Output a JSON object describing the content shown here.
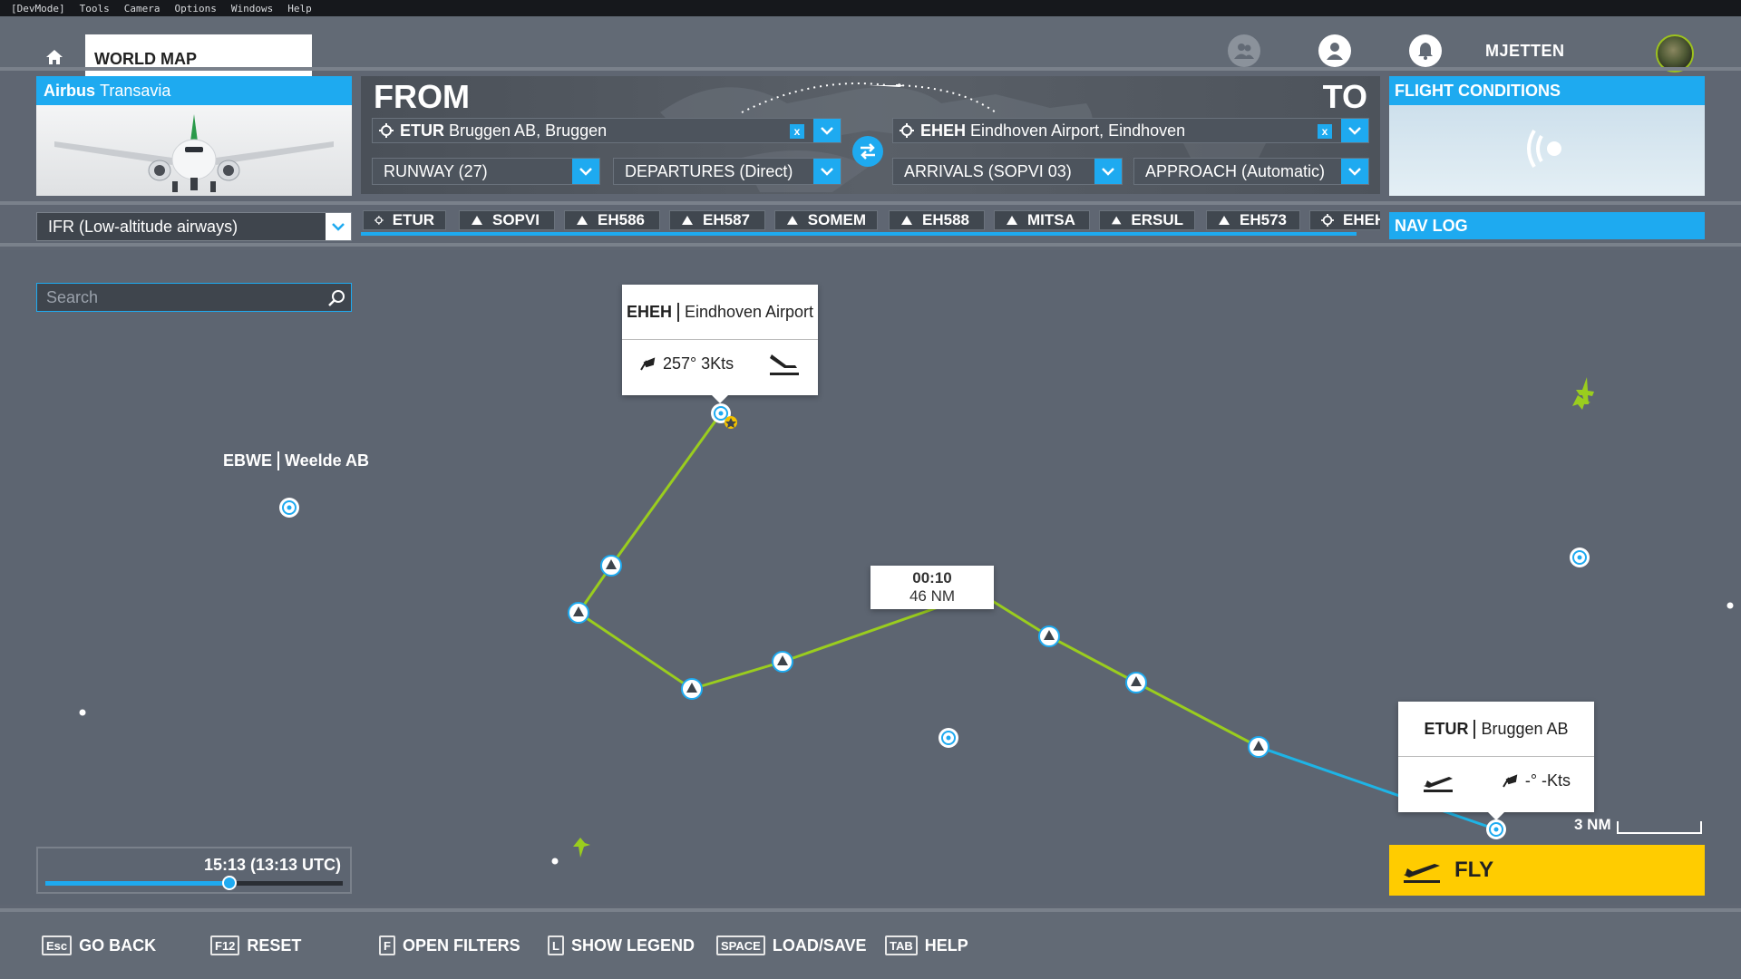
{
  "devmenu": [
    "[DevMode]",
    "Tools",
    "Camera",
    "Options",
    "Windows",
    "Help"
  ],
  "nav": {
    "tab_label": "WORLD MAP",
    "username": "MJETTEN"
  },
  "aircraft": {
    "brand": "Airbus",
    "livery": "Transavia"
  },
  "route": {
    "from_label": "FROM",
    "to_label": "TO",
    "from_code": "ETUR",
    "from_name": "Bruggen AB, Bruggen",
    "to_code": "EHEH",
    "to_name": "Eindhoven Airport, Eindhoven",
    "clear_glyph": "x",
    "runway": "RUNWAY (27)",
    "departure": "DEPARTURES (Direct)",
    "arrival": "ARRIVALS (SOPVI 03)",
    "approach": "APPROACH (Automatic)"
  },
  "flight_conditions": {
    "title": "FLIGHT CONDITIONS"
  },
  "flight_type": "IFR (Low-altitude airways)",
  "waypoints": [
    {
      "label": "ETUR",
      "icon": "airport-icon"
    },
    {
      "label": "SOPVI",
      "icon": "waypoint-triangle-icon"
    },
    {
      "label": "EH586",
      "icon": "waypoint-triangle-icon"
    },
    {
      "label": "EH587",
      "icon": "waypoint-triangle-icon"
    },
    {
      "label": "SOMEM",
      "icon": "waypoint-triangle-icon"
    },
    {
      "label": "EH588",
      "icon": "waypoint-triangle-icon"
    },
    {
      "label": "MITSA",
      "icon": "waypoint-triangle-icon"
    },
    {
      "label": "ERSUL",
      "icon": "waypoint-triangle-icon"
    },
    {
      "label": "EH573",
      "icon": "waypoint-triangle-icon"
    },
    {
      "label": "EHEH",
      "icon": "airport-icon"
    }
  ],
  "navlog": {
    "title": "NAV LOG"
  },
  "search": {
    "placeholder": "Search"
  },
  "map": {
    "dest_callout": {
      "code": "EHEH",
      "name": "Eindhoven Airport",
      "wind": "257° 3Kts"
    },
    "origin_callout": {
      "code": "ETUR",
      "name": "Bruggen AB",
      "wind": "-° -Kts"
    },
    "other_airport": {
      "code": "EBWE",
      "name": "Weelde AB"
    },
    "leg_info": {
      "time": "00:10",
      "distance": "46 NM"
    },
    "scale": "3 NM",
    "route_color": "#9acd1e",
    "active_leg_color": "#1eb4e6"
  },
  "time": {
    "label": "15:13 (13:13 UTC)",
    "position": 0.62
  },
  "fly_label": "FLY",
  "bottom_bar": [
    {
      "key": "Esc",
      "label": "GO BACK"
    },
    {
      "key": "F12",
      "label": "RESET"
    },
    {
      "key": "F",
      "label": "OPEN FILTERS"
    },
    {
      "key": "L",
      "label": "SHOW LEGEND"
    },
    {
      "key": "SPACE",
      "label": "LOAD/SAVE"
    },
    {
      "key": "TAB",
      "label": "HELP"
    }
  ],
  "colors": {
    "accent": "#1eaaf0",
    "fly": "#ffcc00",
    "map": "#5d6571"
  }
}
